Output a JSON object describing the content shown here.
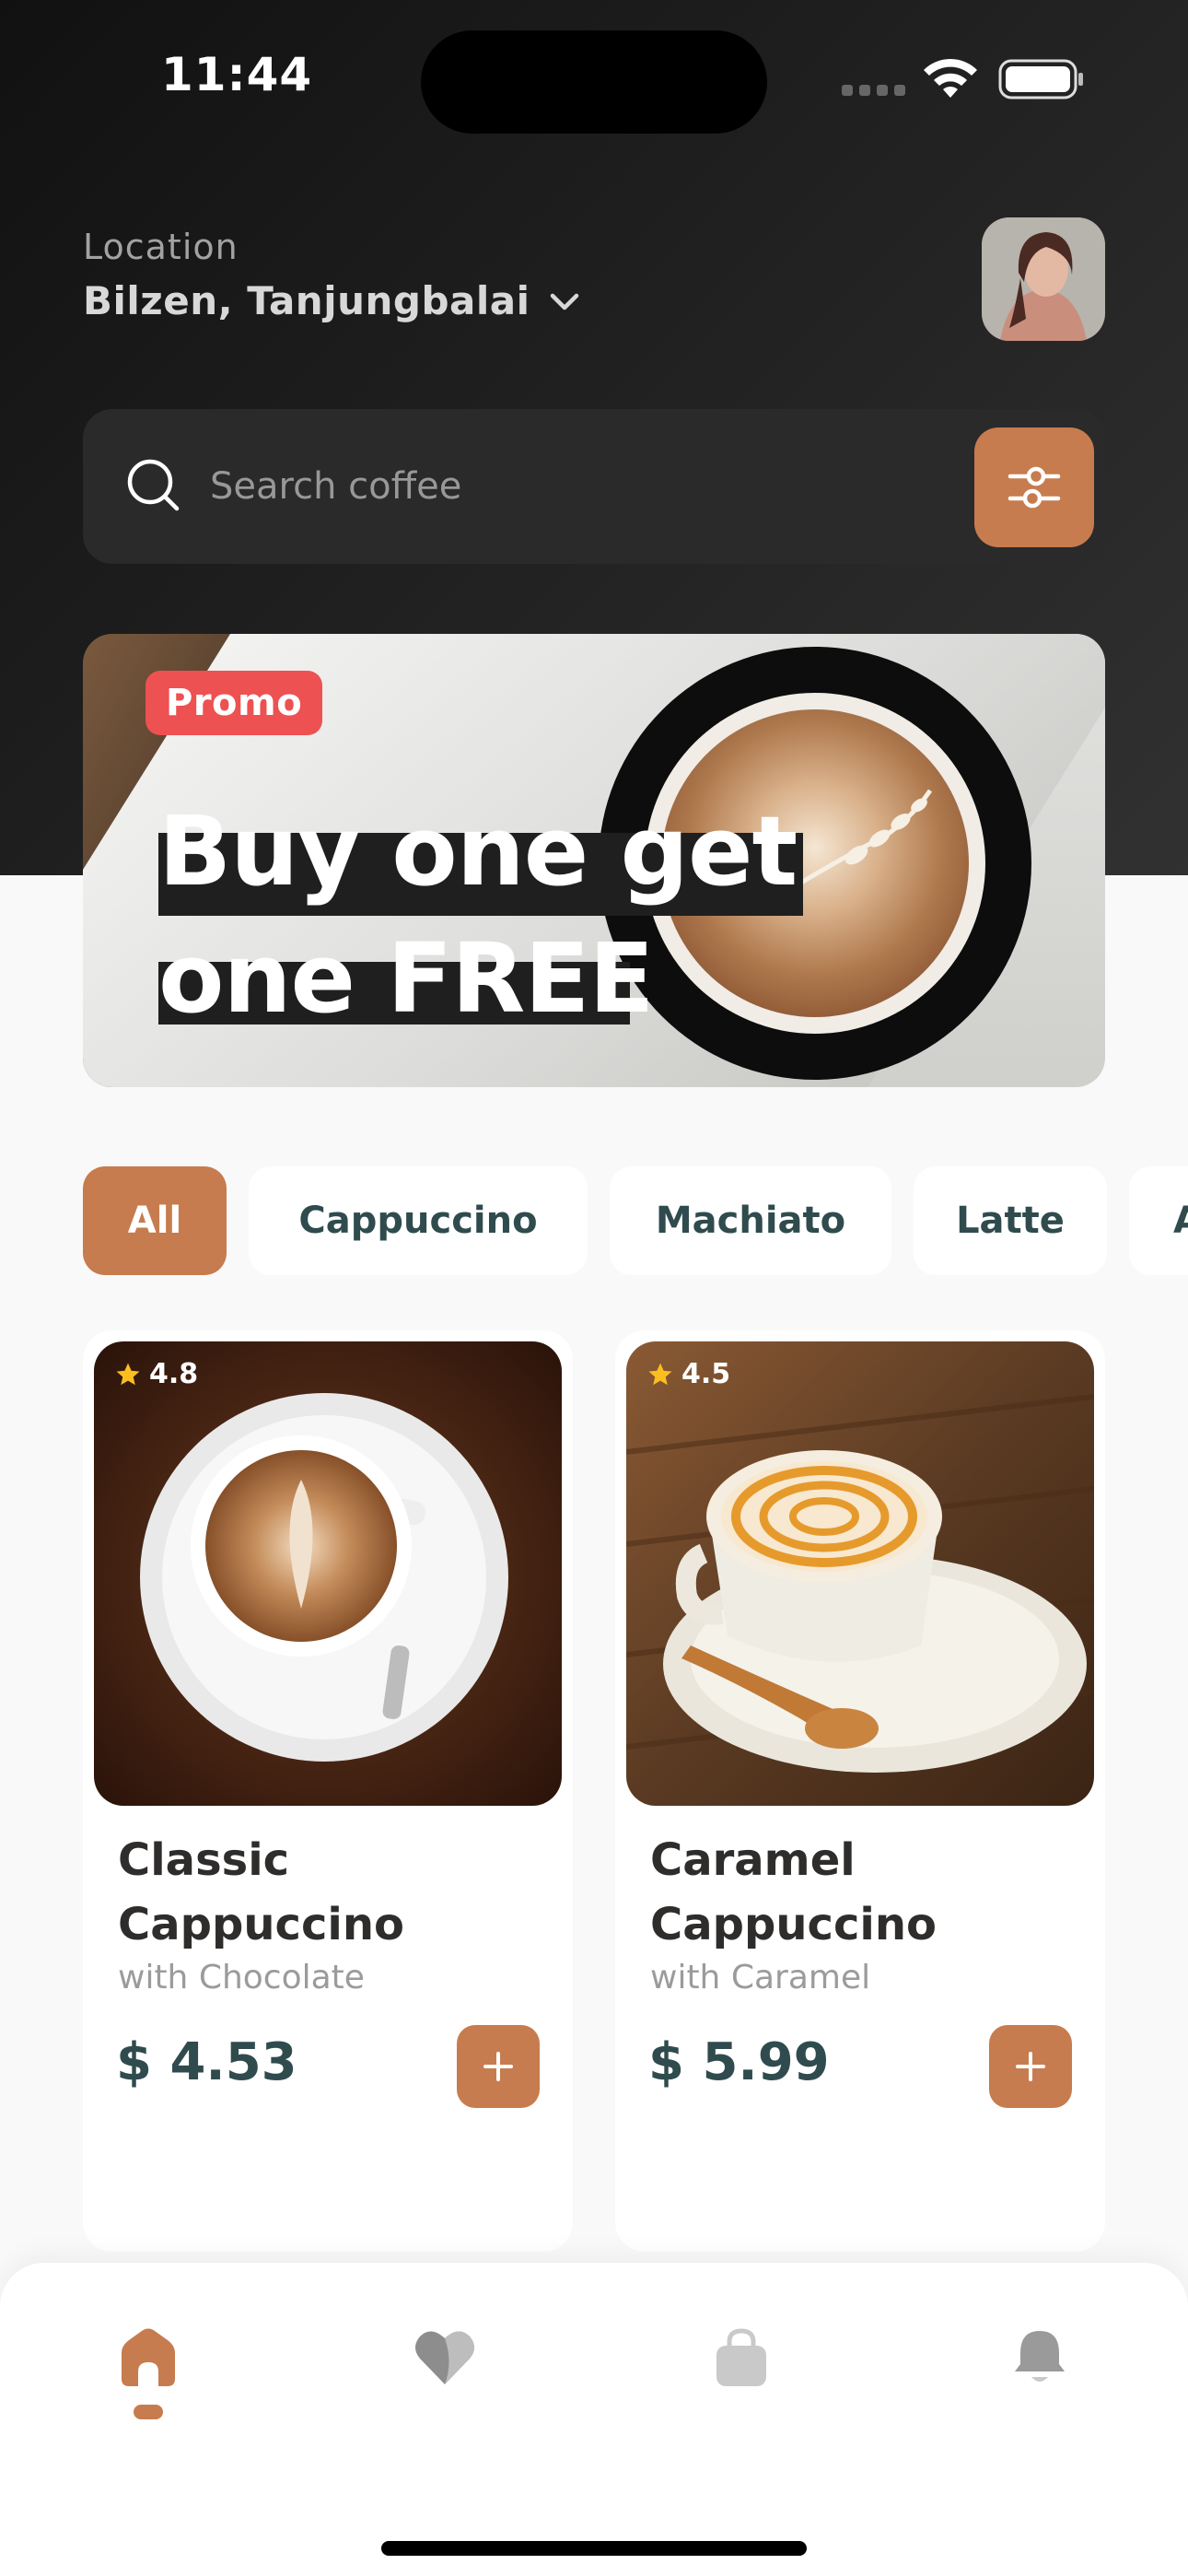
{
  "status_bar": {
    "time": "11:44"
  },
  "header": {
    "location_label": "Location",
    "location_value": "Bilzen, Tanjungbalai"
  },
  "search": {
    "placeholder": "Search coffee"
  },
  "promo": {
    "badge": "Promo",
    "line1": "Buy one get",
    "line2": "one FREE"
  },
  "categories": [
    "All",
    "Cappuccino",
    "Machiato",
    "Latte",
    "A"
  ],
  "products": [
    {
      "rating": "4.8",
      "name": "Classic Cappuccino",
      "subtitle": "with Chocolate",
      "price": "$ 4.53"
    },
    {
      "rating": "4.5",
      "name": "Caramel Cappuccino",
      "subtitle": "with Caramel",
      "price": "$ 5.99"
    }
  ],
  "nav": {
    "items": [
      "home-icon",
      "heart-icon",
      "bag-icon",
      "bell-icon"
    ],
    "active": "home"
  },
  "colors": {
    "accent": "#C67C4E",
    "promo_badge": "#ED5151",
    "header_dark": "#313131",
    "price_text": "#2F4B4E"
  }
}
